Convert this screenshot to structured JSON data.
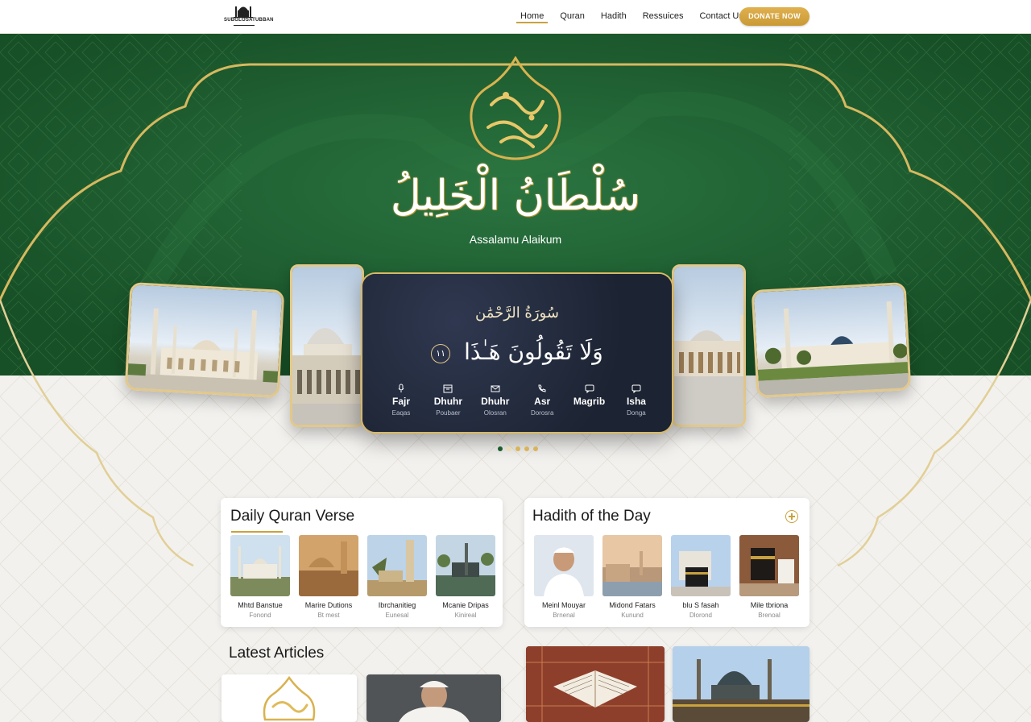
{
  "nav": {
    "logo_text": "SUBGLOSATUBBAN",
    "links": [
      "Home",
      "Quran",
      "Hadith",
      "Ressuices",
      "Contact Us"
    ],
    "active": "Home",
    "donate_label": "DONATE NOW"
  },
  "hero": {
    "arabic_title": "سُلْطَانُ الْخَلِيلُ",
    "greeting": "Assalamu Alaikum"
  },
  "verse_card": {
    "heading": "سُورَةُ الرَّحْمَٰن",
    "verse": "وَلَا تَقُولُونَ هَـٰذَا",
    "verse_number": "١١",
    "prayers": [
      {
        "name": "Fajr",
        "time": "Eaqas",
        "icon": "mic-icon"
      },
      {
        "name": "Dhuhr",
        "time": "Poubaer",
        "icon": "calendar-icon"
      },
      {
        "name": "Dhuhr",
        "time": "Olosran",
        "icon": "mail-icon"
      },
      {
        "name": "Asr",
        "time": "Dorosra",
        "icon": "phone-icon"
      },
      {
        "name": "Magrib",
        "time": "",
        "icon": "chat-icon"
      },
      {
        "name": "Isha",
        "time": "Donga",
        "icon": "chat-icon"
      }
    ]
  },
  "carousel": {
    "slide_count": 5,
    "active_index": 0
  },
  "quran_panel": {
    "title": "Daily Quran Verse",
    "items": [
      {
        "title": "Mhtd Banstue",
        "sub": "Fonond"
      },
      {
        "title": "Marire Dutions",
        "sub": "Bt mest"
      },
      {
        "title": "Ibrchanitieg",
        "sub": "Eunesal"
      },
      {
        "title": "Mcanie Dripas",
        "sub": "Kinireal"
      }
    ]
  },
  "hadith_panel": {
    "title": "Hadith of the Day",
    "items": [
      {
        "title": "Meinl Mouyar",
        "sub": "Brnenal"
      },
      {
        "title": "Midond Fatars",
        "sub": "Kunund"
      },
      {
        "title": "blu S fasah",
        "sub": "Dlorond"
      },
      {
        "title": "Mile tbriona",
        "sub": "Brenoal"
      }
    ]
  },
  "articles": {
    "title": "Latest Articles"
  },
  "colors": {
    "green": "#1c5c2e",
    "gold": "#c9a23e",
    "navy_card": "#232b3b"
  }
}
